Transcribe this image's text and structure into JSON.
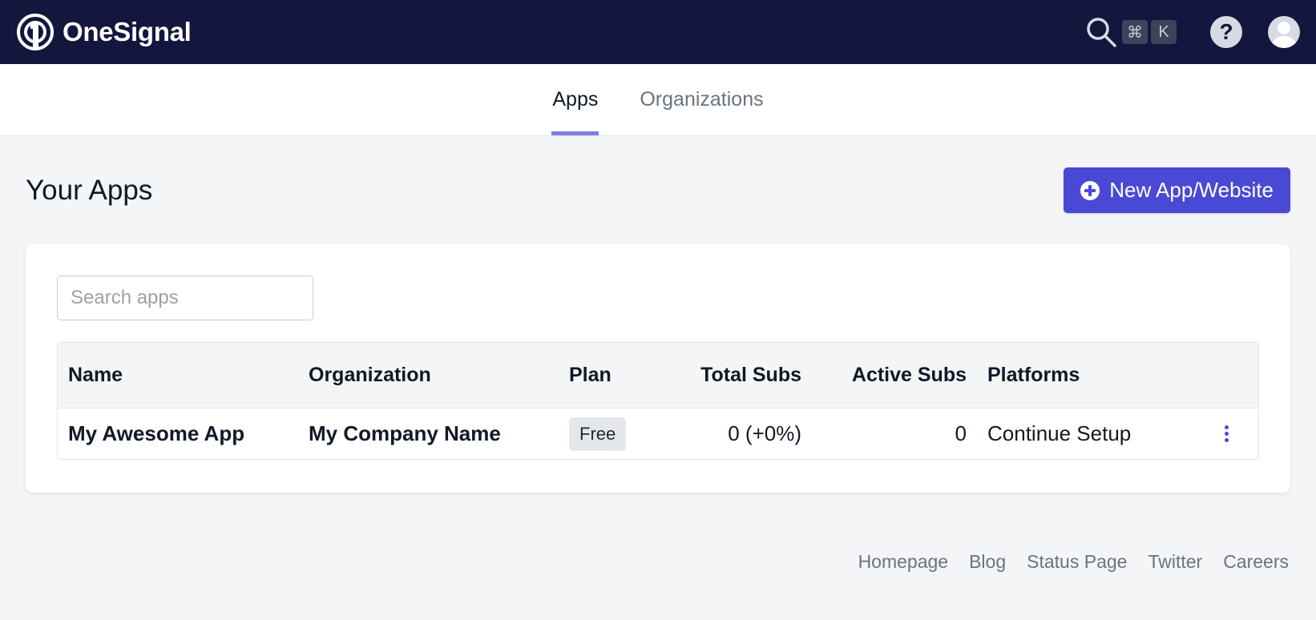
{
  "header": {
    "brand": "OneSignal",
    "shortcut_keys": [
      "⌘",
      "K"
    ],
    "help_glyph": "?"
  },
  "tabs": [
    {
      "label": "Apps",
      "active": true
    },
    {
      "label": "Organizations",
      "active": false
    }
  ],
  "page": {
    "title": "Your Apps",
    "new_button_label": "New App/Website"
  },
  "search": {
    "placeholder": "Search apps",
    "value": ""
  },
  "table": {
    "columns": [
      "Name",
      "Organization",
      "Plan",
      "Total Subs",
      "Active Subs",
      "Platforms"
    ],
    "rows": [
      {
        "name": "My Awesome App",
        "organization": "My Company Name",
        "plan": "Free",
        "total_subs": "0 (+0%)",
        "active_subs": "0",
        "platforms": "Continue Setup"
      }
    ]
  },
  "footer": {
    "links": [
      "Homepage",
      "Blog",
      "Status Page",
      "Twitter",
      "Careers"
    ]
  },
  "colors": {
    "topbar": "#13163d",
    "accent": "#4949d6",
    "tab_indicator": "#7c7fe4",
    "page_bg": "#f4f5f7"
  },
  "icons": [
    "onesignal-logo-icon",
    "search-icon",
    "help-icon",
    "avatar-icon",
    "plus-circle-icon",
    "kebab-menu-icon"
  ]
}
